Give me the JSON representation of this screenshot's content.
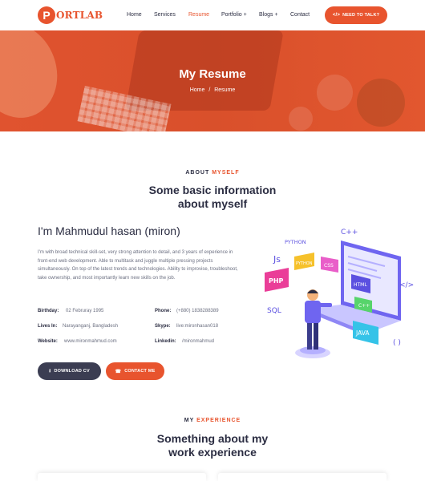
{
  "brand": {
    "logo_letter": "P",
    "logo_text": "ORTLAB",
    "accent": "#e8542e",
    "dark": "#3b3d52"
  },
  "nav": {
    "items": [
      {
        "label": "Home",
        "active": false
      },
      {
        "label": "Services",
        "active": false
      },
      {
        "label": "Resume",
        "active": true
      },
      {
        "label": "Portfolio +",
        "active": false
      },
      {
        "label": "Blogs +",
        "active": false
      },
      {
        "label": "Contact",
        "active": false
      }
    ],
    "cta_label": "NEED TO TALK?",
    "cta_icon": "code-icon"
  },
  "hero": {
    "title": "My Resume",
    "breadcrumb": {
      "home": "Home",
      "separator": "/",
      "current": "Resume"
    }
  },
  "about": {
    "tag_prefix": "ABOUT",
    "tag_accent": "MYSELF",
    "heading_line1": "Some basic information",
    "heading_line2": "about myself",
    "name": "I'm Mahmudul hasan (miron)",
    "bio": "I'm with broad technical skill-set, very strong attention to detail, and 3 years of experience in front-end web development. Able to multitask and juggle multiple pressing projects simultaneously. On top of the latest trends and technologies. Ability to improvise, troubleshoot, take ownership, and most importantly learn new skills on the job.",
    "info": [
      {
        "label": "Birthday:",
        "value": "02 Februray 1995"
      },
      {
        "label": "Phone:",
        "value": "(+880) 1838288389"
      },
      {
        "label": "Lives In:",
        "value": "Narayanganj, Bangladesh"
      },
      {
        "label": "Skype:",
        "value": "live:mironhasan018"
      },
      {
        "label": "Website:",
        "value": "www.mironmahmud.com"
      },
      {
        "label": "Linkedin:",
        "value": "/mironmahmud"
      }
    ],
    "buttons": {
      "download": "DOWNLOAD CV",
      "contact": "CONTACT ME"
    },
    "illustration_labels": {
      "python": "PYTHON",
      "cpp": "C++",
      "js": "Js",
      "python_tag": "PYTHON",
      "css": "CSS",
      "html": "HTML",
      "php": "PHP",
      "cpp2": "C++",
      "sql": "SQL",
      "java": "JAVA",
      "code_tag": "</>",
      "brace": "( )"
    }
  },
  "experience": {
    "tag_prefix": "MY",
    "tag_accent": "EXPERIENCE",
    "heading_line1": "Something about my",
    "heading_line2": "work experience"
  }
}
